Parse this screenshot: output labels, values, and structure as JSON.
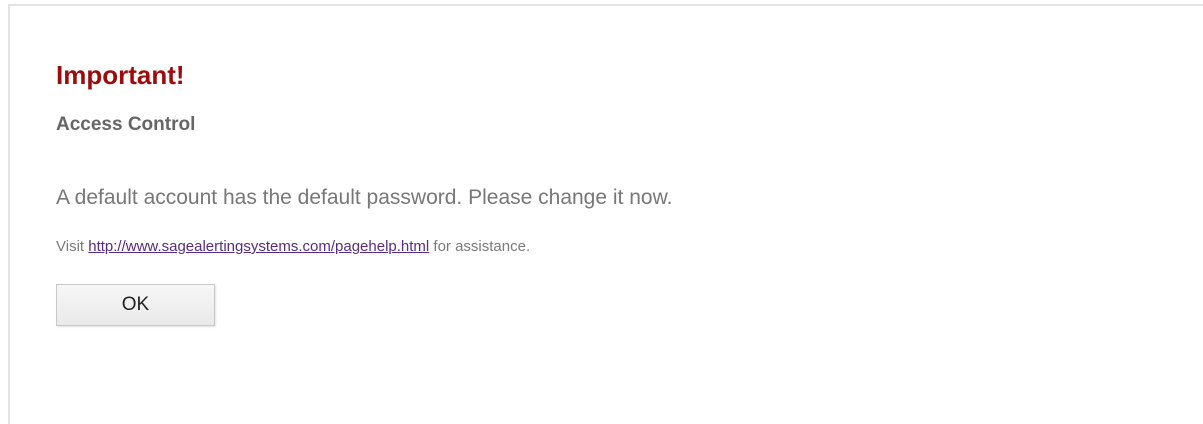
{
  "dialog": {
    "title": "Important!",
    "subtitle": "Access Control",
    "message": "A default account has the default password. Please change it now.",
    "help": {
      "prefix": "Visit",
      "link_text": "http://www.sagealertingsystems.com/pagehelp.html",
      "suffix": "for assistance."
    },
    "ok_label": "OK"
  },
  "colors": {
    "title": "#9b0c0c",
    "link": "#5b2a86",
    "text": "#777777"
  }
}
